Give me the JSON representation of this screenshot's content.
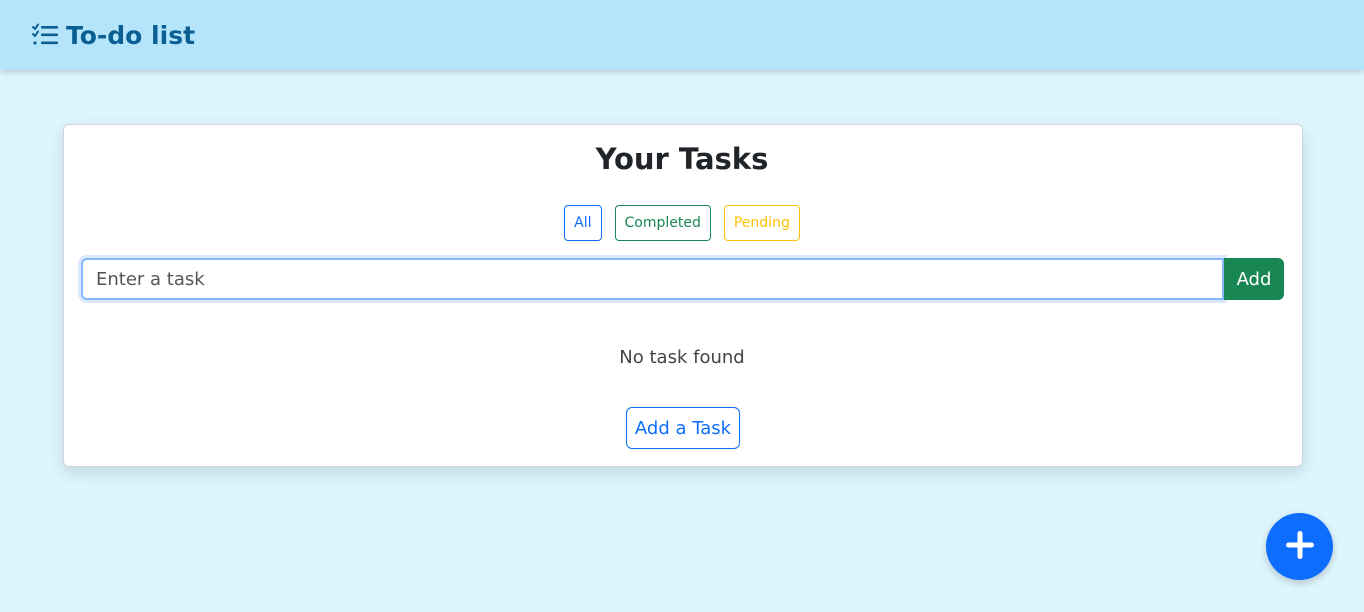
{
  "navbar": {
    "brand_label": "To-do list",
    "brand_icon": "checklist-icon"
  },
  "main": {
    "title": "Your Tasks",
    "filters": [
      {
        "label": "All",
        "color": "#0d6efd"
      },
      {
        "label": "Completed",
        "color": "#198754"
      },
      {
        "label": "Pending",
        "color": "#ffc107"
      }
    ],
    "task_input": {
      "placeholder": "Enter a task",
      "value": ""
    },
    "add_label": "Add",
    "empty_message": "No task found",
    "add_task_label": "Add a Task"
  },
  "fab": {
    "icon": "plus-icon"
  },
  "colors": {
    "primary": "#0d6efd",
    "success": "#198754",
    "warning": "#ffc107",
    "navbar_bg": "#b4e5fa",
    "page_bg": "#def5fd"
  }
}
